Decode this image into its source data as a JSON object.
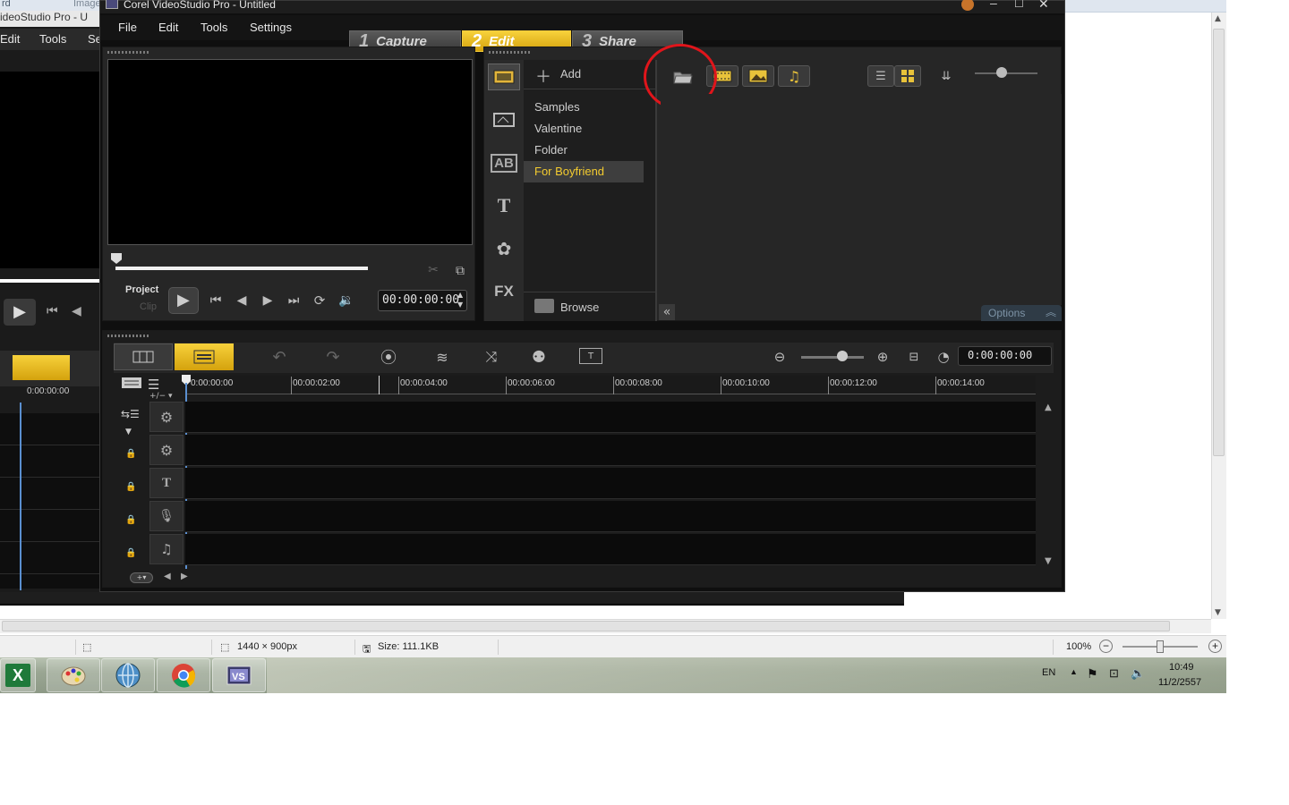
{
  "background_window": {
    "top_left_labels": [
      "rd",
      "Image"
    ],
    "status": {
      "dimensions": "1440 × 900px",
      "size": "Size: 111.1KB",
      "zoom": "100%"
    }
  },
  "old_window": {
    "title": "ideoStudio Pro - U",
    "menu": [
      "Edit",
      "Tools",
      "Se"
    ],
    "timecode": "0:00:00:00"
  },
  "app": {
    "title": "Corel VideoStudio Pro - Untitled",
    "menu": [
      "File",
      "Edit",
      "Tools",
      "Settings"
    ],
    "steps": [
      {
        "num": "1",
        "label": "Capture"
      },
      {
        "num": "2",
        "label": "Edit"
      },
      {
        "num": "3",
        "label": "Share"
      }
    ],
    "player": {
      "project_label": "Project",
      "clip_label": "Clip",
      "timecode": "00:00:00:00"
    },
    "library": {
      "add_label": "Add",
      "folders": [
        "Samples",
        "Valentine",
        "Folder",
        "For Boyfriend"
      ],
      "selected_folder": "For Boyfriend",
      "browse_label": "Browse",
      "options_label": "Options",
      "fx_label": "FX"
    },
    "timeline": {
      "timecode": "0:00:00:00",
      "ruler": [
        "0:00:00:00",
        "00:00:02:00",
        "00:00:04:00",
        "00:00:06:00",
        "00:00:08:00",
        "00:00:10:00",
        "00:00:12:00",
        "00:00:14:00"
      ]
    }
  },
  "taskbar": {
    "language": "EN",
    "time": "10:49",
    "date": "11/2/2557"
  },
  "colors": {
    "accent_yellow": "#f2c02d",
    "selected_text": "#f3cb2f",
    "annotation_red": "#e0151b"
  }
}
